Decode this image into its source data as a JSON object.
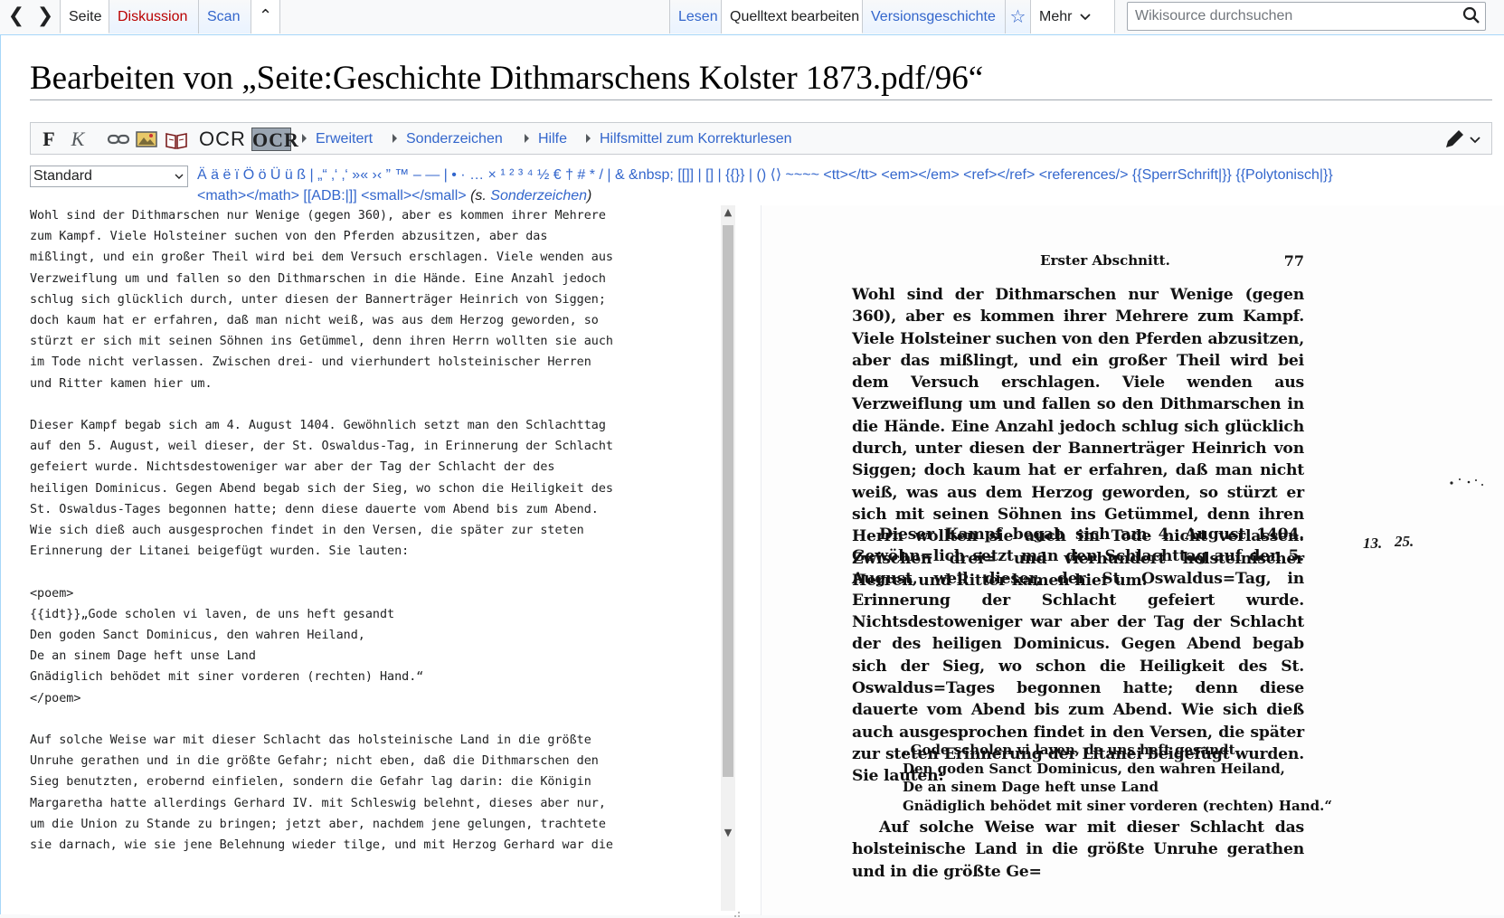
{
  "top_nav": {
    "back_glyph": "❮",
    "forward_glyph": "❯",
    "tabs_left": [
      {
        "label": "Seite"
      },
      {
        "label": "Diskussion"
      },
      {
        "label": "Scan"
      }
    ],
    "collapse_glyph": "⌃",
    "tabs_right": [
      {
        "label": "Lesen"
      },
      {
        "label": "Quelltext bearbeiten"
      },
      {
        "label": "Versionsgeschichte"
      }
    ],
    "more_label": "Mehr",
    "star_glyph": "☆",
    "search_placeholder": "Wikisource durchsuchen"
  },
  "page": {
    "title": "Bearbeiten von „Seite:Geschichte Dithmarschens Kolster 1873.pdf/96“"
  },
  "toolbar": {
    "bold": "F",
    "italic": "K",
    "ocr1": "OCR",
    "ocr2": "OCR",
    "menus": [
      "Erweitert",
      "Sonderzeichen",
      "Hilfe",
      "Hilfsmittel zum Korrekturlesen"
    ]
  },
  "special_chars": {
    "select_value": "Standard",
    "line1": "Ä ä ë ï Ö ö Ü ü ß | „“ ‚‘ ‚‘ »« ›‹ ” ™ – — | • · … × ¹ ² ³ ⁴ ½ € † # * / | & &nbsp; [[]] | [] | {{}} | () ⟨⟩ ~~~~ <tt></tt> <em></em> <ref></ref> <references/> {{SperrSchrift|}} {{Polytonisch|}}",
    "line2_link": "<math></math> [[ADB:|]] <small></small>",
    "line2_note_prefix": "(s. ",
    "line2_note_link": "Sonderzeichen",
    "line2_note_suffix": ")"
  },
  "editor": {
    "text": "Wohl sind der Dithmarschen nur Wenige (gegen 360), aber es kommen ihrer Mehrere\nzum Kampf. Viele Holsteiner suchen von den Pferden abzusitzen, aber das\nmißlingt, und ein großer Theil wird bei dem Versuch erschlagen. Viele wenden aus\nVerzweiflung um und fallen so den Dithmarschen in die Hände. Eine Anzahl jedoch\nschlug sich glücklich durch, unter diesen der Bannerträger Heinrich von Siggen;\ndoch kaum hat er erfahren, daß man nicht weiß, was aus dem Herzog geworden, so\nstürzt er sich mit seinen Söhnen ins Getümmel, denn ihren Herrn wollten sie auch\nim Tode nicht verlassen. Zwischen drei- und vierhundert holsteinischer Herren\nund Ritter kamen hier um.\n\nDieser Kampf begab sich am 4. August 1404. Gewöhnlich setzt man den Schlachttag\nauf den 5. August, weil dieser, der St. Oswaldus-Tag, in Erinnerung der Schlacht\ngefeiert wurde. Nichtsdestoweniger war aber der Tag der Schlacht der des\nheiligen Dominicus. Gegen Abend begab sich der Sieg, wo schon die Heiligkeit des\nSt. Oswaldus-Tages begonnen hatte; denn diese dauerte vom Abend bis zum Abend.\nWie sich dieß auch ausgesprochen findet in den Versen, die später zur steten\nErinnerung der Litanei beigefügt wurden. Sie lauten:\n\n<poem>\n{{idt}}„Gode scholen vi laven, de uns heft gesandt\nDen goden Sanct Dominicus, den wahren Heiland,\nDe an sinem Dage heft unse Land\nGnädiglich behödet mit siner vorderen (rechten) Hand.“\n</poem>\n\nAuf solche Weise war mit dieser Schlacht das holsteinische Land in die größte\nUnruhe gerathen und in die größte Gefahr; nicht eben, daß die Dithmarschen den\nSieg benutzten, erobernd einfielen, sondern die Gefahr lag darin: die Königin\nMargaretha hatte allerdings Gerhard IV. mit Schleswig belehnt, dieses aber nur,\num die Union zu Stande zu bringen; jetzt aber, nachdem jene gelungen, trachtete\nsie darnach, wie sie jene Belehnung wieder tilge, und mit Herzog Gerhard war die"
  },
  "scan": {
    "header": "Erster Abschnitt.",
    "page_number": "77",
    "para1": "Wohl sind der Dithmarschen nur Wenige (gegen 360), aber es kommen ihrer Mehrere zum Kampf. Viele Holsteiner suchen von den Pferden abzusitzen, aber das mißlingt, und ein großer Theil wird bei dem Versuch erschlagen. Viele wenden aus Verzweiflung um und fallen so den Dithmarschen in die Hände. Eine Anzahl jedoch schlug sich glücklich durch, unter diesen der Bannerträger Heinrich von Siggen; doch kaum hat er erfahren, daß man nicht weiß, was aus dem Herzog geworden, so stürzt er sich mit seinen Söhnen ins Getümmel, denn ihren Herrn wollten sie auch im Tode nicht verlassen. Zwischen drei= und vierhundert holsteinischer Herren und Ritter kamen hier um.",
    "para2": "Dieser Kampf begab sich am 4. August 1404. Gewöhn=lich setzt man den Schlachttag auf den 5. August, weil dieser, der St. Oswaldus=Tag, in Erinnerung der Schlacht gefeiert wurde. Nichtsdestoweniger war aber der Tag der Schlacht der des heiligen Dominicus. Gegen Abend begab sich der Sieg, wo schon die Heiligkeit des St. Oswaldus=Tages begonnen hatte; denn diese dauerte vom Abend bis zum Abend. Wie sich dieß auch ausgesprochen findet in den Versen, die später zur steten Erinnerung der Litanei beigefügt wurden. Sie lauten:",
    "poem": "„Gode scholen vi laven, de uns heft gesandt\nDen goden Sanct Dominicus, den wahren Heiland,\nDe an sinem Dage heft unse Land\nGnädiglich behödet mit siner vorderen (rechten) Hand.“",
    "para3": "Auf solche Weise war mit dieser Schlacht das holsteinische Land in die größte Unruhe gerathen und in die größte Ge=",
    "margin_note_1": "13.",
    "margin_note_2": "25."
  }
}
